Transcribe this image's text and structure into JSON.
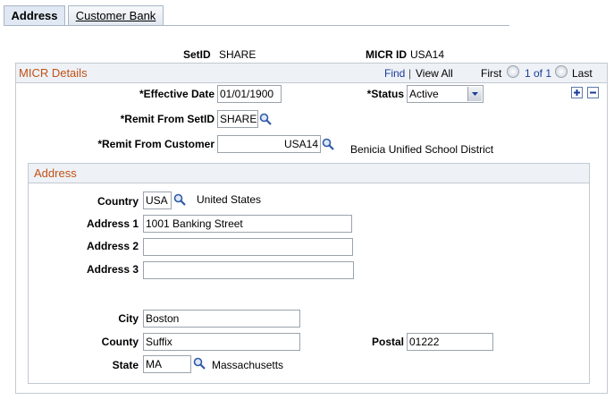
{
  "tabs": [
    {
      "label": "Address",
      "active": true
    },
    {
      "label": "Customer Bank",
      "active": false
    }
  ],
  "header": {
    "setid_label": "SetID",
    "setid_value": "SHARE",
    "micrid_label": "MICR ID",
    "micrid_value": "USA14"
  },
  "micr": {
    "title": "MICR Details",
    "find": "Find",
    "separator": "|",
    "view_all": "View All",
    "first": "First",
    "page_info": "1 of 1",
    "last": "Last",
    "effective_date_label": "*Effective Date",
    "effective_date_value": "01/01/1900",
    "status_label": "*Status",
    "status_value": "Active",
    "remit_setid_label": "*Remit From SetID",
    "remit_setid_value": "SHARE",
    "remit_customer_label": "*Remit From Customer",
    "remit_customer_value": "USA14",
    "customer_name": "Benicia Unified School District"
  },
  "address": {
    "title": "Address",
    "country_label": "Country",
    "country_value": "USA",
    "country_name": "United States",
    "address1_label": "Address 1",
    "address1_value": "1001 Banking Street",
    "address2_label": "Address 2",
    "address2_value": "",
    "address3_label": "Address 3",
    "address3_value": "",
    "city_label": "City",
    "city_value": "Boston",
    "county_label": "County",
    "county_value": "Suffix",
    "postal_label": "Postal",
    "postal_value": "01222",
    "state_label": "State",
    "state_value": "MA",
    "state_name": "Massachusetts"
  },
  "colors": {
    "section_title": "#c25116",
    "link": "#1a3a9a",
    "header_bg": "#eef2f7"
  }
}
